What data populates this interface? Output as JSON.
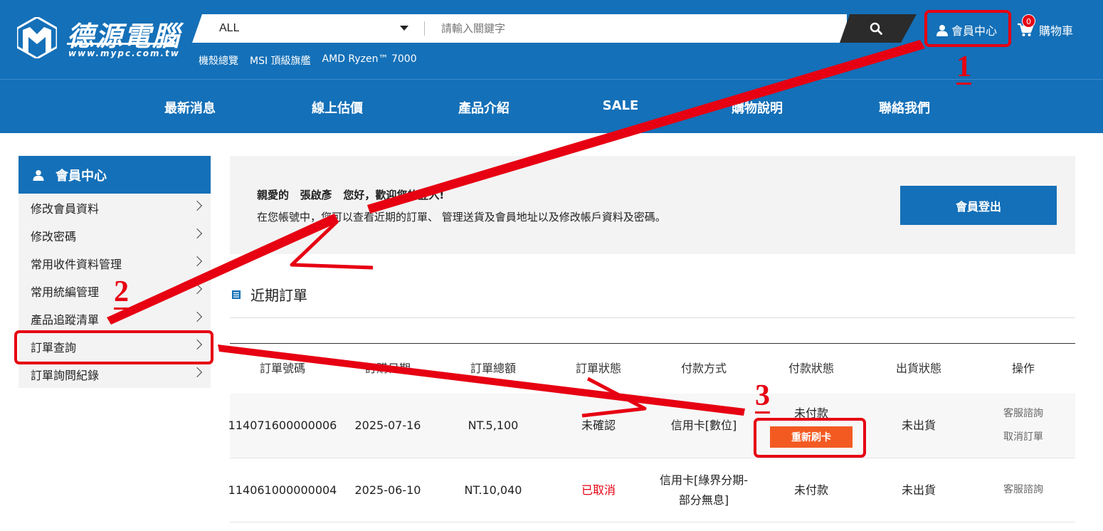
{
  "brand": {
    "name": "德源電腦",
    "url": "www.mypc.com.tw"
  },
  "search": {
    "category": "ALL",
    "placeholder": "請輸入關鍵字"
  },
  "quick_links": [
    "機殼總覽",
    "MSI 頂級旗艦",
    "AMD Ryzen™ 7000"
  ],
  "header_actions": {
    "member_center": "會員中心",
    "cart": "購物車",
    "cart_count": "0"
  },
  "nav": [
    "最新消息",
    "線上估價",
    "產品介紹",
    "SALE",
    "購物說明",
    "聯絡我們"
  ],
  "sidebar": {
    "title": "會員中心",
    "items": [
      "修改會員資料",
      "修改密碼",
      "常用收件資料管理",
      "常用統編管理",
      "產品追蹤清單",
      "訂單查詢",
      "訂單詢問紀錄"
    ]
  },
  "welcome": {
    "line1": "親愛的   張啟彥   您好，歡迎您的登入!",
    "line2": "在您帳號中，您可以查看近期的訂單、 管理送貨及會員地址以及修改帳戶資料及密碼。",
    "logout": "會員登出"
  },
  "orders": {
    "title": "近期訂單",
    "headers": [
      "訂單號碼",
      "訂購日期",
      "訂單總額",
      "訂單狀態",
      "付款方式",
      "付款狀態",
      "出貨狀態",
      "操作"
    ],
    "rows": [
      {
        "id": "114071600000006",
        "date": "2025-07-16",
        "total": "NT.5,100",
        "status": "未確認",
        "payment_method": "信用卡[數位]",
        "payment_status": "未付款",
        "pay_button": "重新刷卡",
        "shipping": "未出貨",
        "op1": "客服諮詢",
        "op2": "取消訂單"
      },
      {
        "id": "114061000000004",
        "date": "2025-06-10",
        "total": "NT.10,040",
        "status": "已取消",
        "payment_method_line1": "信用卡[綠界分期-",
        "payment_method_line2": "部分無息]",
        "payment_status": "未付款",
        "shipping": "未出貨",
        "op1": "客服諮詢"
      }
    ]
  },
  "annotations": {
    "step1": "1",
    "step2": "2",
    "step3": "3",
    "color": "#e60012"
  },
  "colors": {
    "primary": "#1470b8",
    "accent": "#f35a22",
    "alert": "#e60012"
  }
}
